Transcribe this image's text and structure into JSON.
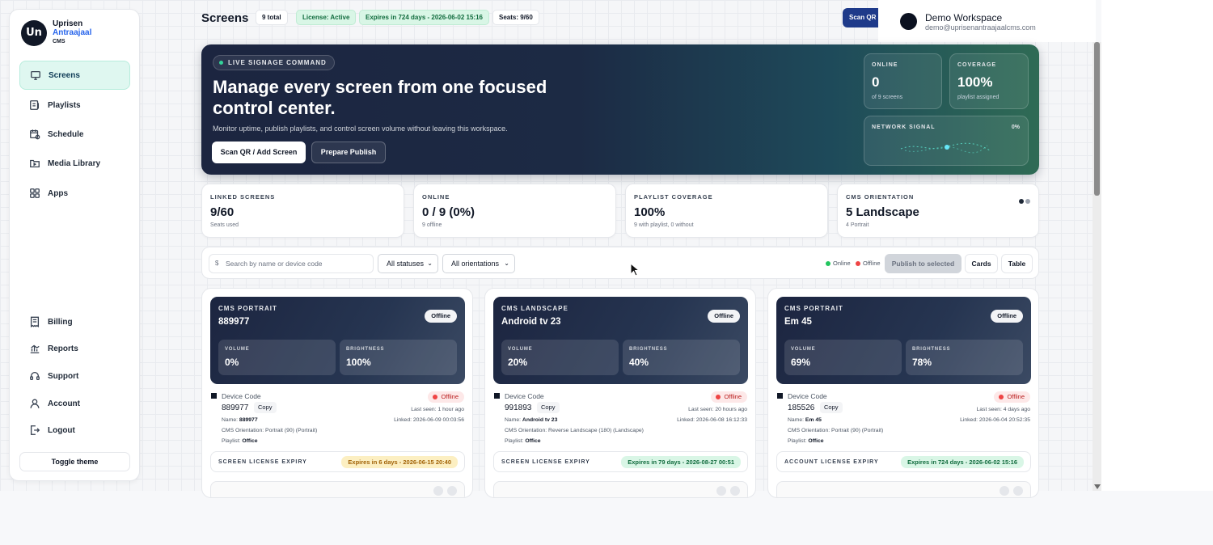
{
  "brand": {
    "initials": "Un",
    "line1": "Uprisen",
    "line2": "Antraajaal",
    "line3": "CMS"
  },
  "sidebar": {
    "items": [
      {
        "label": "Screens",
        "icon": "monitor-icon",
        "active": true
      },
      {
        "label": "Playlists",
        "icon": "playlist-icon"
      },
      {
        "label": "Schedule",
        "icon": "calendar-icon"
      },
      {
        "label": "Media Library",
        "icon": "folder-icon"
      },
      {
        "label": "Apps",
        "icon": "apps-grid-icon"
      }
    ],
    "bottom_items": [
      {
        "label": "Billing",
        "icon": "receipt-icon"
      },
      {
        "label": "Reports",
        "icon": "chart-icon"
      },
      {
        "label": "Support",
        "icon": "headset-icon"
      },
      {
        "label": "Account",
        "icon": "user-icon"
      },
      {
        "label": "Logout",
        "icon": "logout-icon"
      }
    ],
    "toggle_theme": "Toggle theme"
  },
  "header": {
    "title": "Screens",
    "chips": [
      "9 total",
      "License: Active",
      "Expires in 724 days - 2026-06-02 15:16",
      "Seats: 9/60"
    ],
    "scan_button": "Scan QR"
  },
  "workspace": {
    "name": "Demo Workspace",
    "email": "demo@uprisenantraajaalcms.com"
  },
  "hero": {
    "badge": "LIVE SIGNAGE COMMAND",
    "title": "Manage every screen from one focused control center.",
    "subtitle": "Monitor uptime, publish playlists, and control screen volume without leaving this workspace.",
    "primary_button": "Scan QR / Add Screen",
    "secondary_button": "Prepare Publish",
    "online": {
      "label": "ONLINE",
      "value": "0",
      "sub": "of 9 screens"
    },
    "coverage": {
      "label": "COVERAGE",
      "value": "100%",
      "sub": "playlist assigned"
    },
    "network": {
      "label": "NETWORK SIGNAL",
      "value": "0%"
    }
  },
  "stats": [
    {
      "label": "LINKED SCREENS",
      "value": "9/60",
      "sub": "Seats used"
    },
    {
      "label": "ONLINE",
      "value": "0 / 9 (0%)",
      "sub": "9 offline"
    },
    {
      "label": "PLAYLIST COVERAGE",
      "value": "100%",
      "sub": "9 with playlist, 0 without"
    },
    {
      "label": "CMS ORIENTATION",
      "value": "5 Landscape",
      "sub": "4 Portrait"
    }
  ],
  "toolbar": {
    "search_icon": "$",
    "search_placeholder": "Search by name or device code",
    "status_select": "All statuses",
    "orientation_select": "All orientations",
    "legend_online": "Online",
    "legend_offline": "Offline",
    "publish_selected": "Publish to selected",
    "view_cards": "Cards",
    "view_table": "Table"
  },
  "screens": [
    {
      "kind": "CMS PORTRAIT",
      "name": "889977",
      "badge": "Offline",
      "volume_label": "VOLUME",
      "volume": "0%",
      "brightness_label": "BRIGHTNESS",
      "brightness": "100%",
      "device_code_label": "Device Code",
      "device_code": "889977",
      "copy": "Copy",
      "meta_name_label": "Name:",
      "meta_name": "889977",
      "meta_orientation_label": "CMS Orientation:",
      "meta_orientation": "Portrait (90) (Portrait)",
      "meta_playlist_label": "Playlist:",
      "meta_playlist": "Office",
      "status": "Offline",
      "last_seen": "Last seen: 1 hour ago",
      "linked": "Linked: 2026-06-09 00:03:56",
      "license_label": "SCREEN LICENSE EXPIRY",
      "license_value": "Expires in 6 days - 2026-06-15 20:40",
      "license_state": "warn"
    },
    {
      "kind": "CMS LANDSCAPE",
      "name": "Android tv 23",
      "badge": "Offline",
      "volume_label": "VOLUME",
      "volume": "20%",
      "brightness_label": "BRIGHTNESS",
      "brightness": "40%",
      "device_code_label": "Device Code",
      "device_code": "991893",
      "copy": "Copy",
      "meta_name_label": "Name:",
      "meta_name": "Android tv 23",
      "meta_orientation_label": "CMS Orientation:",
      "meta_orientation": "Reverse Landscape (180) (Landscape)",
      "meta_playlist_label": "Playlist:",
      "meta_playlist": "Office",
      "status": "Offline",
      "last_seen": "Last seen: 20 hours ago",
      "linked": "Linked: 2026-06-08 16:12:33",
      "license_label": "SCREEN LICENSE EXPIRY",
      "license_value": "Expires in 79 days - 2026-08-27 00:51",
      "license_state": "ok"
    },
    {
      "kind": "CMS PORTRAIT",
      "name": "Em 45",
      "badge": "Offline",
      "volume_label": "VOLUME",
      "volume": "69%",
      "brightness_label": "BRIGHTNESS",
      "brightness": "78%",
      "device_code_label": "Device Code",
      "device_code": "185526",
      "copy": "Copy",
      "meta_name_label": "Name:",
      "meta_name": "Em 45",
      "meta_orientation_label": "CMS Orientation:",
      "meta_orientation": "Portrait (90) (Portrait)",
      "meta_playlist_label": "Playlist:",
      "meta_playlist": "Office",
      "status": "Offline",
      "last_seen": "Last seen: 4 days ago",
      "linked": "Linked: 2026-06-04 20:52:35",
      "license_label": "ACCOUNT LICENSE EXPIRY",
      "license_value": "Expires in 724 days - 2026-06-02 15:16",
      "license_state": "ok"
    }
  ],
  "colors": {
    "accent": "#2563eb",
    "online": "#22c55e",
    "offline": "#ef4444",
    "hero_dark": "#1c2540",
    "hero_green": "#2f6b55"
  }
}
